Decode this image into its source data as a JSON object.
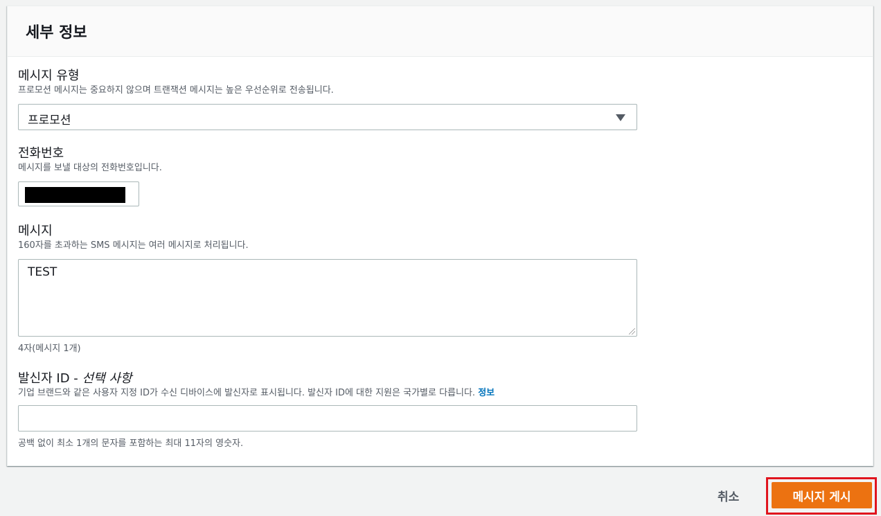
{
  "panel": {
    "title": "세부 정보"
  },
  "message_type": {
    "label": "메시지 유형",
    "description": "프로모션 메시지는 중요하지 않으며 트랜잭션 메시지는 높은 우선순위로 전송됩니다.",
    "selected": "프로모션"
  },
  "phone": {
    "label": "전화번호",
    "description": "메시지를 보낼 대상의 전화번호입니다."
  },
  "message": {
    "label": "메시지",
    "description": "160자를 초과하는 SMS 메시지는 여러 메시지로 처리됩니다.",
    "value": "TEST",
    "counter": "4자(메시지 1개)"
  },
  "sender_id": {
    "label": "발신자 ID - ",
    "label_optional": "선택 사항",
    "description": "기업 브랜드와 같은 사용자 지정 ID가 수신 디바이스에 발신자로 표시됩니다. 발신자 ID에 대한 지원은 국가별로 다릅니다. ",
    "info_link": "정보",
    "value": "",
    "hint": "공백 없이 최소 1개의 문자를 포함하는 최대 11자의 영숫자."
  },
  "actions": {
    "cancel": "취소",
    "submit": "메시지 게시"
  },
  "colors": {
    "accent": "#ec7211",
    "highlight": "#e0141e",
    "link": "#0073bb"
  }
}
